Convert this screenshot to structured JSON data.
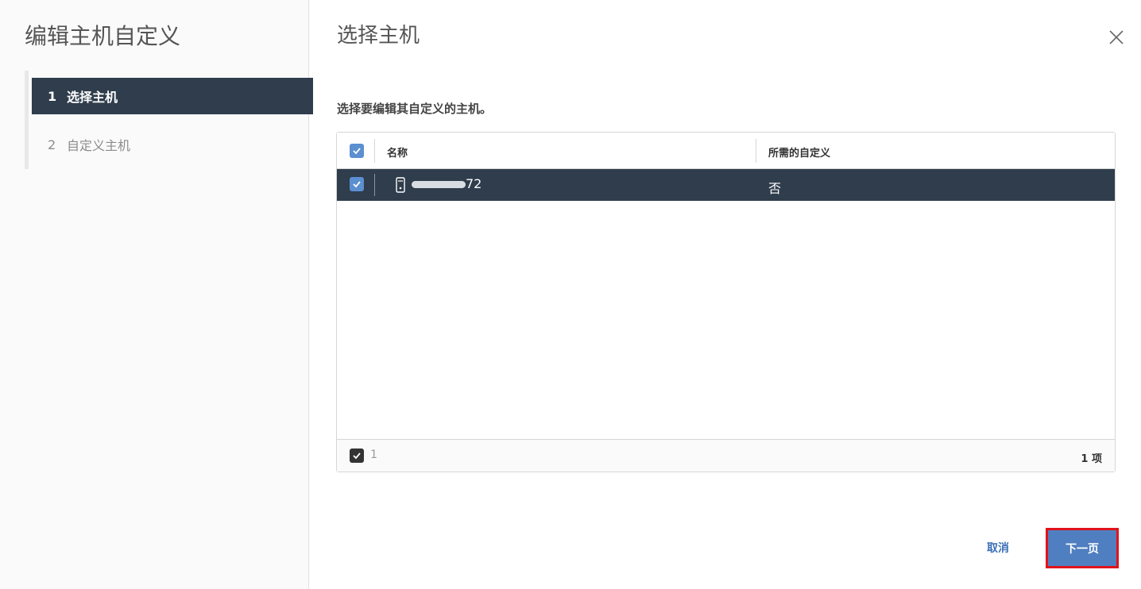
{
  "sidebar": {
    "title": "编辑主机自定义",
    "steps": [
      {
        "num": "1",
        "label": "选择主机",
        "state": "active"
      },
      {
        "num": "2",
        "label": "自定义主机",
        "state": "inactive"
      }
    ]
  },
  "main": {
    "title": "选择主机",
    "instructions": "选择要编辑其自定义的主机。"
  },
  "grid": {
    "columns": [
      "名称",
      "所需的自定义"
    ],
    "rows": [
      {
        "name_suffix": "72",
        "customization": "否",
        "selected": true,
        "icon": "host-icon"
      }
    ],
    "footer": {
      "selected_count": "1",
      "total_items": "1 项"
    }
  },
  "buttons": {
    "cancel": "取消",
    "next": "下一页"
  },
  "colors": {
    "selected_row": "#2f3d4c",
    "checkbox": "#5b8fd0",
    "primary_button": "#4f7fc0",
    "highlight_border": "#e0131b"
  }
}
